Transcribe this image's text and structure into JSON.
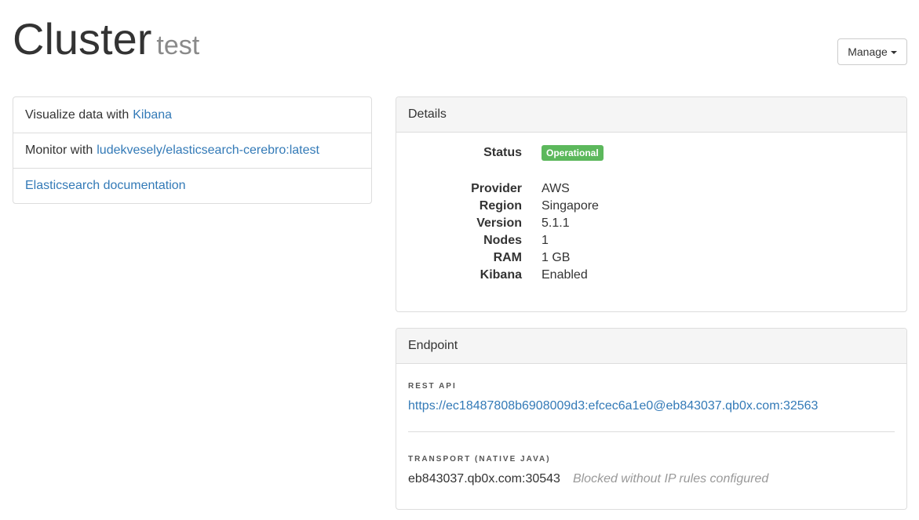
{
  "header": {
    "title": "Cluster",
    "subtitle": "test",
    "manage_label": "Manage"
  },
  "links": {
    "items": [
      {
        "prefix": "Visualize data with",
        "link": "Kibana"
      },
      {
        "prefix": "Monitor with",
        "link": "ludekvesely/elasticsearch-cerebro:latest"
      },
      {
        "prefix": "",
        "link": "Elasticsearch documentation"
      }
    ]
  },
  "details": {
    "heading": "Details",
    "status_label": "Status",
    "status_value": "Operational",
    "status_color": "#5cb85c",
    "rows": [
      {
        "label": "Provider",
        "value": "AWS"
      },
      {
        "label": "Region",
        "value": "Singapore"
      },
      {
        "label": "Version",
        "value": "5.1.1"
      },
      {
        "label": "Nodes",
        "value": "1"
      },
      {
        "label": "RAM",
        "value": "1 GB"
      },
      {
        "label": "Kibana",
        "value": "Enabled"
      }
    ]
  },
  "endpoint": {
    "heading": "Endpoint",
    "rest_label": "REST API",
    "rest_url": "https://ec18487808b6908009d3:efcec6a1e0@eb843037.qb0x.com:32563",
    "transport_label": "TRANSPORT (NATIVE JAVA)",
    "transport_value": "eb843037.qb0x.com:30543",
    "transport_note": "Blocked without IP rules configured"
  },
  "colors": {
    "link": "#337ab7",
    "panel_heading_bg": "#f5f5f5",
    "border": "#dddddd"
  }
}
